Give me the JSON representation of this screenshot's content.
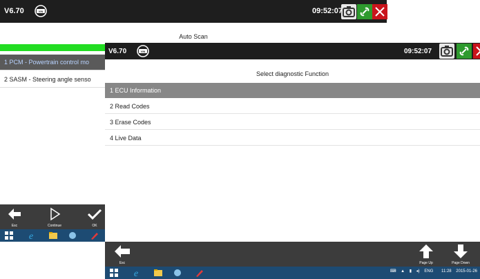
{
  "back_window": {
    "version": "V6.70",
    "time": "09:52:07",
    "title": "Auto Scan",
    "rows": [
      "1  PCM - Powertrain control mo",
      "2  SASM - Steering angle senso"
    ],
    "buttons": [
      {
        "label": "Esc"
      },
      {
        "label": "Continue"
      },
      {
        "label": "OK"
      }
    ]
  },
  "front_window": {
    "version": "V6.70",
    "time": "09:52:07",
    "title": "Select diagnostic Function",
    "menu": [
      "1  ECU Information",
      "2  Read Codes",
      "3  Erase Codes",
      "4  Live Data"
    ],
    "buttons": {
      "esc": "Esc",
      "page_up": "Page Up",
      "page_down": "Page Down"
    },
    "tray": {
      "lang": "ENG",
      "clock_time": "11:28",
      "clock_date": "2015-01-26"
    }
  },
  "colors": {
    "topbar": "#1e1e1e",
    "selected_row_back": "#5a5a5a",
    "selected_row_front": "#878787",
    "green_strip": "#22dd22",
    "link_button": "#2e9a2e",
    "close_button": "#c9141c",
    "taskbar": "#1d4b73"
  }
}
